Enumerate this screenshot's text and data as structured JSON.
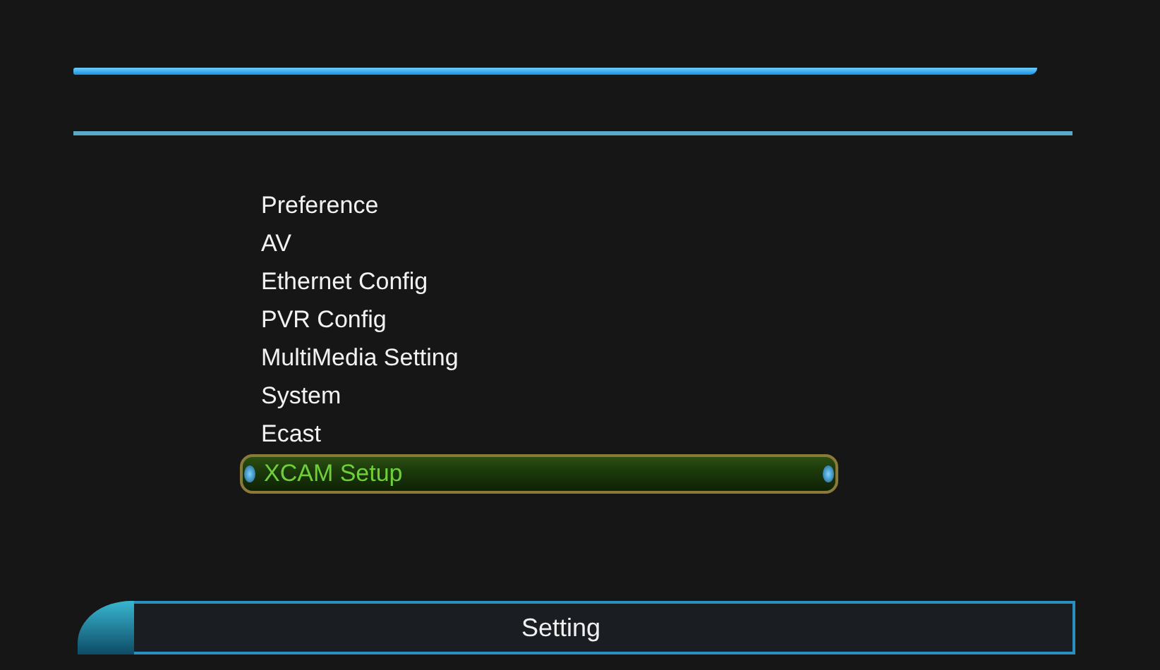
{
  "menu": {
    "items": [
      {
        "label": "Preference",
        "selected": false
      },
      {
        "label": "AV",
        "selected": false
      },
      {
        "label": "Ethernet Config",
        "selected": false
      },
      {
        "label": "PVR Config",
        "selected": false
      },
      {
        "label": "MultiMedia Setting",
        "selected": false
      },
      {
        "label": "System",
        "selected": false
      },
      {
        "label": "Ecast",
        "selected": false
      },
      {
        "label": "XCAM Setup",
        "selected": true
      }
    ]
  },
  "footer": {
    "title": "Setting"
  }
}
